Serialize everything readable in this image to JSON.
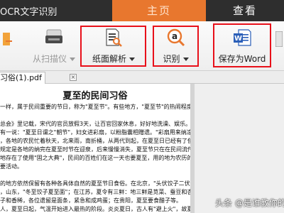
{
  "app": {
    "title": "OCR文字识别"
  },
  "tabs": [
    {
      "label": "主页"
    },
    {
      "label": "查看"
    }
  ],
  "toolbar": {
    "scan_label": "从扫描仪",
    "page_parse_label": "纸面解析",
    "recognize_label": "识别",
    "save_word_label": "保存为Word"
  },
  "document": {
    "tab_label": "习俗(1).pdf",
    "close_glyph": "×",
    "title": "夏至的民间习俗",
    "lines": [
      "一样，属于民间重要的节日，称为\"夏至节\"。有些地方，\"夏至节\"的热闹程度不亚",
      "",
      "总会》里记载，宋代的官员放假3天，让百官回家休息，好好地洗澡、娱乐。",
      "有一说：\"夏至日谓之\"朝节\"，妇女进彩扇，以粉脂囊相赠遗。\"彩扇用来纳凉，香囊",
      "，各地的农民忙着秋天，北来雨，南折桶，从两代到起，在夏至日已经有了使用",
      "规定是各地的纳完在夏至时节在迎泉，后来慢慢消失，夏至节只在在民间流传，如",
      "地存在了使用\"固之大典\"，民间的百姓们在这一天也要夏至，用的地为农历的这",
      "要活动。",
      "",
      "的地方依然保留有各种各具体自然的夏至节日食俗。在北京，\"头伏饺子二伏面，三伏",
      "，山东，\"冬至饺子夏至面\"；在江苏，夏令有三鲜：地三鲜是苋菜、蚕豆和杏仁",
      "子和香稀，各位遗留是面条，紧急和成鸡蛋；在贵阳，夏至要食醋子等。",
      "",
      "人，夏至日起，气温开始进入最热的阶段。炎炎夏日，古人有\"避上火\"，故夏季有"
    ]
  },
  "watermark": {
    "text": "头条 @是谁教你的"
  },
  "colors": {
    "titlebar_bg": "#2e2e2e",
    "active_tab_bg": "#e8772e",
    "highlight_frame": "#e8101a",
    "word_blue": "#2b5fb8"
  },
  "icons": {
    "scan": "scanner-icon",
    "page_parse": "document-magnifier-icon",
    "recognize": "letter-a-magnifier-icon",
    "save_word": "word-document-icon"
  }
}
